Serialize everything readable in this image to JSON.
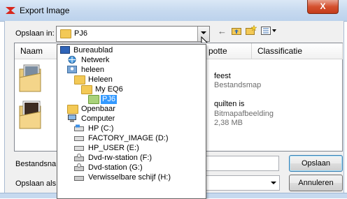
{
  "window": {
    "title": "Export Image",
    "close_glyph": "X"
  },
  "top": {
    "save_in_label": "Opslaan in:",
    "save_in_value": "PJ6"
  },
  "toolbar": {
    "icons": [
      "back-arrow-icon",
      "up-folder-icon",
      "new-folder-icon",
      "view-menu-icon"
    ]
  },
  "list": {
    "columns": [
      "Naam",
      "potte",
      "Classificatie"
    ],
    "items": [
      {
        "title": "feest",
        "subtitle": "Bestandsmap",
        "size": ""
      },
      {
        "title": "quilten is",
        "subtitle": "Bitmapafbeelding",
        "size": "2,38 MB"
      }
    ]
  },
  "bottom": {
    "filename_label": "Bestandsna",
    "saveas_label": "Opslaan als",
    "save_button": "Opslaan",
    "cancel_button": "Annuleren"
  },
  "dropdown": {
    "items": [
      {
        "label": "Bureaublad",
        "icon": "desktop-icon"
      },
      {
        "label": "Netwerk",
        "icon": "network-icon"
      },
      {
        "label": "heleen",
        "icon": "user-folder-icon"
      },
      {
        "label": "Heleen",
        "icon": "folder-icon"
      },
      {
        "label": "My EQ6",
        "icon": "folder-icon"
      },
      {
        "label": "PJ6",
        "icon": "folder-icon",
        "selected": true
      },
      {
        "label": "Openbaar",
        "icon": "folder-icon"
      },
      {
        "label": "Computer",
        "icon": "computer-icon"
      },
      {
        "label": "HP (C:)",
        "icon": "drive-icon"
      },
      {
        "label": "FACTORY_IMAGE (D:)",
        "icon": "drive-icon"
      },
      {
        "label": "HP_USER (E:)",
        "icon": "drive-icon"
      },
      {
        "label": "Dvd-rw-station (F:)",
        "icon": "dvd-drive-icon"
      },
      {
        "label": "Dvd-station (G:)",
        "icon": "dvd-drive-icon"
      },
      {
        "label": "Verwisselbare schijf (H:)",
        "icon": "removable-drive-icon"
      }
    ]
  },
  "colors": {
    "selection": "#3399ff",
    "titlebar": "#c6d9ef",
    "close": "#c33b1a"
  }
}
